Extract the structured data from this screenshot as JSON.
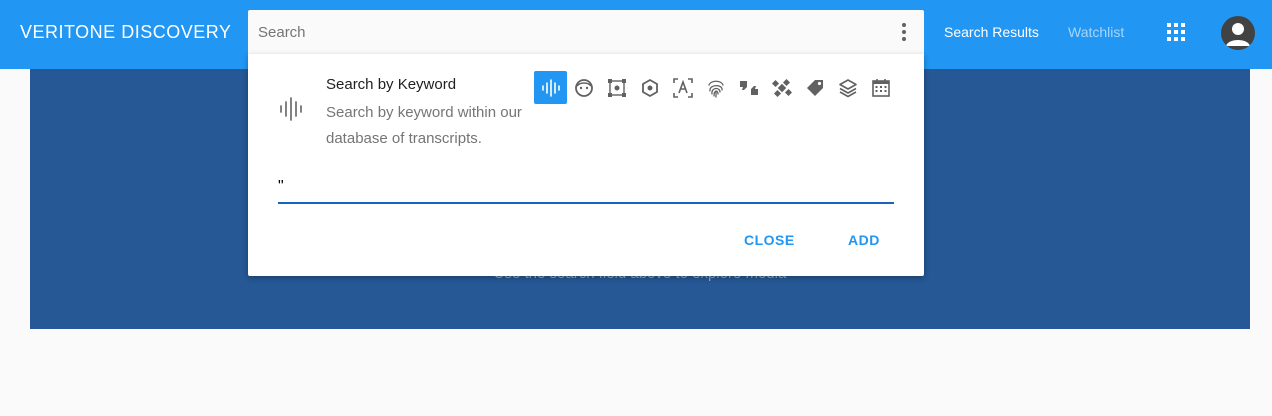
{
  "app": {
    "brand": "VERITONE DISCOVERY"
  },
  "search": {
    "placeholder": "Search"
  },
  "nav": {
    "search_results": "Search Results",
    "watchlist": "Watchlist"
  },
  "hero": {
    "message": "Use the search field above to explore media"
  },
  "panel": {
    "title": "Search by Keyword",
    "description": "Search by keyword within our database of transcripts.",
    "keyword_value": "\"",
    "close_label": "CLOSE",
    "add_label": "ADD",
    "engine_icons": [
      "transcript-icon",
      "face-icon",
      "object-icon",
      "logo-icon",
      "text-recognition-icon",
      "fingerprint-icon",
      "sentiment-icon",
      "geolocation-icon",
      "tag-icon",
      "layers-icon",
      "calendar-icon"
    ],
    "active_engine": "transcript-icon"
  },
  "colors": {
    "accent": "#2196f3",
    "hero": "#265896",
    "underline": "#1565c0"
  }
}
